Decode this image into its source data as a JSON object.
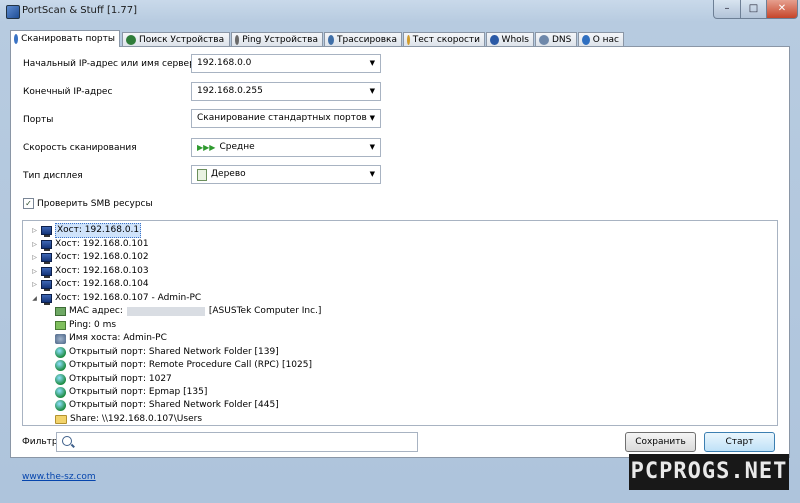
{
  "window": {
    "title": "PortScan & Stuff [1.77]",
    "minimize": "–",
    "maximize": "□",
    "close": "✕"
  },
  "tabs": [
    {
      "label": "Сканировать порты",
      "icon": "scan-icon",
      "color": "#3a73c4"
    },
    {
      "label": "Поиск Устройства",
      "icon": "find-icon",
      "color": "#2f7d3a"
    },
    {
      "label": "Ping Устройства",
      "icon": "ping-icon",
      "color": "#6a6a6a"
    },
    {
      "label": "Трассировка",
      "icon": "trace-icon",
      "color": "#3f6fa8"
    },
    {
      "label": "Тест скорости",
      "icon": "speed-icon",
      "color": "#d19b2b"
    },
    {
      "label": "WhoIs",
      "icon": "whois-icon",
      "color": "#2b5aa6"
    },
    {
      "label": "DNS",
      "icon": "dns-icon",
      "color": "#6e88aa"
    },
    {
      "label": "О нас",
      "icon": "info-icon",
      "color": "#2f6fc0"
    }
  ],
  "form": {
    "start_ip_label": "Начальный IP-адрес или имя сервера",
    "start_ip_value": "192.168.0.0",
    "end_ip_label": "Конечный IP-адрес",
    "end_ip_value": "192.168.0.255",
    "ports_label": "Порты",
    "ports_value": "Сканирование стандартных портов",
    "speed_label": "Скорость сканирования",
    "speed_value": "Средне",
    "display_label": "Тип дисплея",
    "display_value": "Дерево",
    "smb_label": "Проверить SMB ресурсы",
    "smb_checked": true
  },
  "tree": {
    "hosts": [
      "Хост: 192.168.0.1",
      "Хост: 192.168.0.101",
      "Хост: 192.168.0.102",
      "Хост: 192.168.0.103",
      "Хост: 192.168.0.104",
      "Хост: 192.168.0.107 - Admin-PC"
    ],
    "details": {
      "mac_prefix": "MAC адрес:",
      "mac_vendor": "[ASUSTek Computer Inc.]",
      "ping": "Ping: 0 ms",
      "hostname": "Имя хоста: Admin-PC",
      "ports": [
        "Открытый порт: Shared Network Folder [139]",
        "Открытый порт: Remote Procedure Call (RPC) [1025]",
        "Открытый порт: 1027",
        "Открытый порт: Epmap [135]",
        "Открытый порт: Shared Network Folder [445]"
      ],
      "share": "Share: \\\\192.168.0.107\\Users"
    }
  },
  "filter": {
    "label": "Фильтр",
    "value": ""
  },
  "buttons": {
    "save": "Сохранить",
    "start": "Старт"
  },
  "footer": {
    "link": "www.the-sz.com"
  },
  "watermark": "PCPROGS.NET"
}
